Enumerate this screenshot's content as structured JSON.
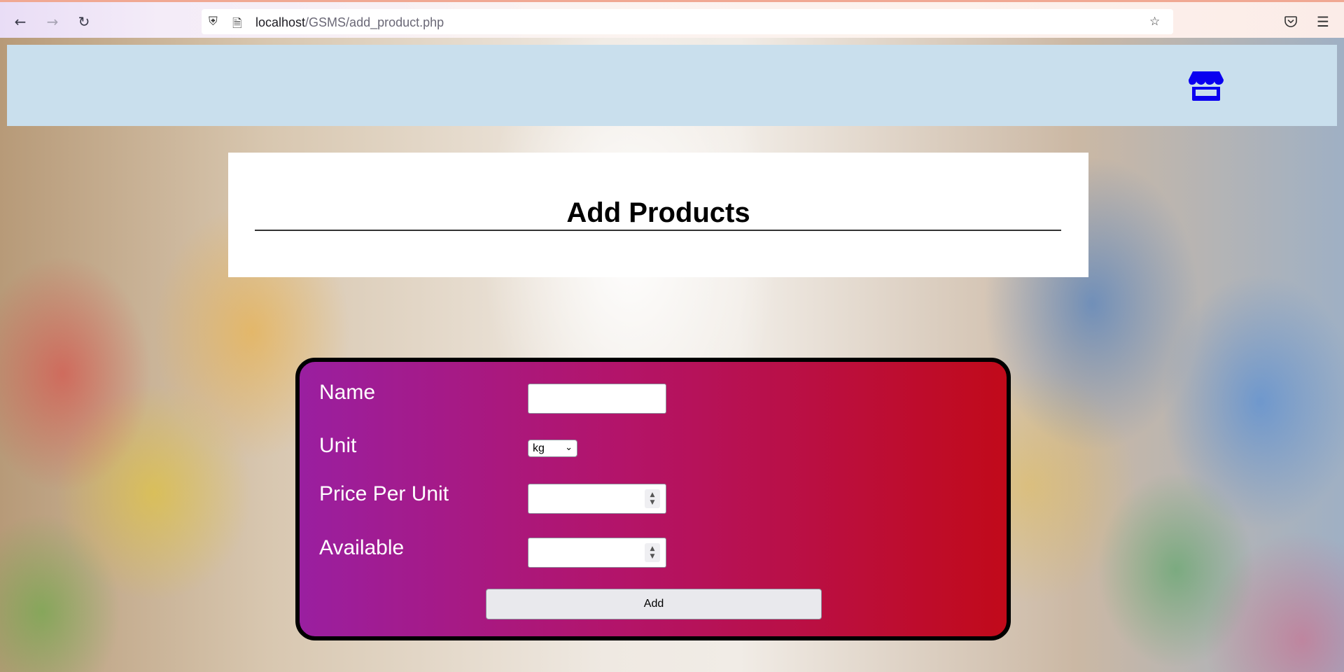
{
  "browser": {
    "url_host": "localhost",
    "url_path": "/GSMS/add_product.php",
    "back_icon": "arrow-left-icon",
    "forward_icon": "arrow-right-icon",
    "reload_icon": "reload-icon",
    "shield_icon": "shield-icon",
    "page_icon": "page-icon",
    "bookmark_icon": "star-icon",
    "pocket_icon": "pocket-icon",
    "menu_icon": "hamburger-menu-icon"
  },
  "header": {
    "logo_icon": "store-icon",
    "logo_color": "#0a00f0",
    "background_color": "#c9dfed"
  },
  "title_card": {
    "title": "Add Products"
  },
  "form": {
    "gradient_start": "#9a1fa0",
    "gradient_end": "#c10a1a",
    "fields": [
      {
        "label": "Name",
        "value": ""
      },
      {
        "label": "Unit",
        "value": "kg"
      },
      {
        "label": "Price Per Unit",
        "value": ""
      },
      {
        "label": "Available",
        "value": ""
      }
    ],
    "submit_label": "Add"
  }
}
